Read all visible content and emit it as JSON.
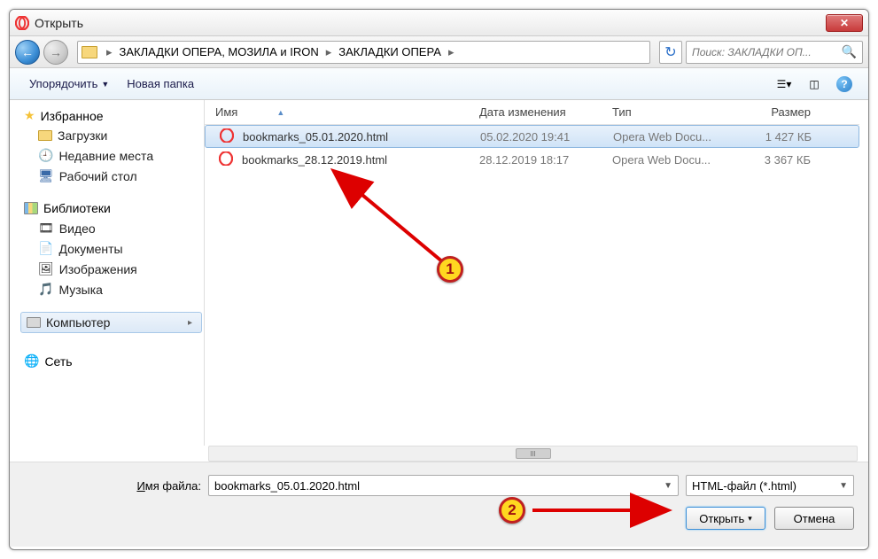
{
  "window": {
    "title": "Открыть"
  },
  "breadcrumb": {
    "parts": [
      "ЗАКЛАДКИ ОПЕРА,  МОЗИЛА и IRON",
      "ЗАКЛАДКИ ОПЕРА"
    ]
  },
  "search": {
    "placeholder": "Поиск: ЗАКЛАДКИ ОП..."
  },
  "toolbar": {
    "organize": "Упорядочить",
    "new_folder": "Новая папка"
  },
  "sidebar": {
    "favorites": {
      "label": "Избранное",
      "items": [
        "Загрузки",
        "Недавние места",
        "Рабочий стол"
      ]
    },
    "libraries": {
      "label": "Библиотеки",
      "items": [
        "Видео",
        "Документы",
        "Изображения",
        "Музыка"
      ]
    },
    "computer": {
      "label": "Компьютер"
    },
    "network": {
      "label": "Сеть"
    }
  },
  "columns": {
    "name": "Имя",
    "date": "Дата изменения",
    "type": "Тип",
    "size": "Размер"
  },
  "files": [
    {
      "name": "bookmarks_05.01.2020.html",
      "date": "05.02.2020 19:41",
      "type": "Opera Web Docu...",
      "size": "1 427 КБ",
      "selected": true
    },
    {
      "name": "bookmarks_28.12.2019.html",
      "date": "28.12.2019 18:17",
      "type": "Opera Web Docu...",
      "size": "3 367 КБ",
      "selected": false
    }
  ],
  "footer": {
    "filename_label": "Имя файла:",
    "filename_value": "bookmarks_05.01.2020.html",
    "filetype": "HTML-файл (*.html)",
    "open": "Открыть",
    "cancel": "Отмена"
  },
  "annotations": {
    "marker1": "1",
    "marker2": "2"
  }
}
